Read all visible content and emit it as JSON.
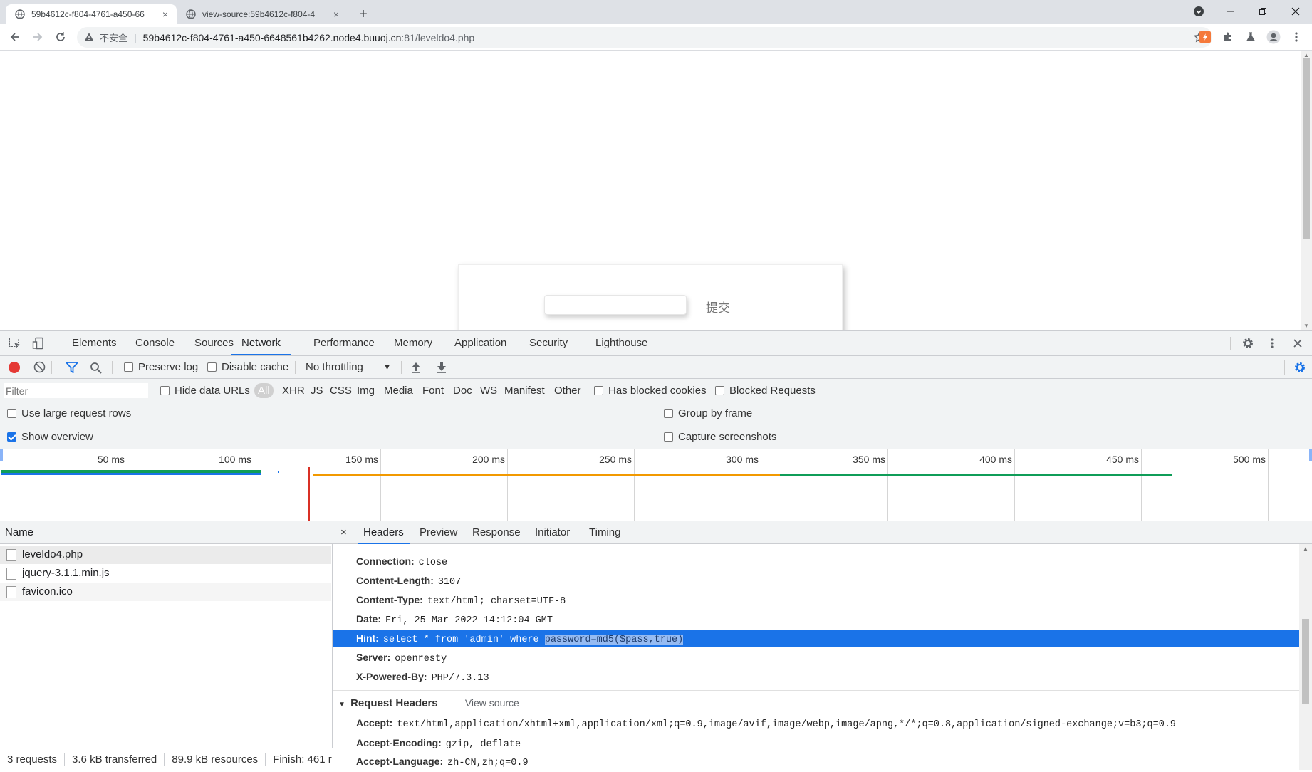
{
  "tabs": [
    {
      "title": "59b4612c-f804-4761-a450-66",
      "close": "×"
    },
    {
      "title": "view-source:59b4612c-f804-4",
      "close": "×"
    }
  ],
  "new_tab": "+",
  "toolbar": {
    "security_label": "不安全",
    "url_host": "59b4612c-f804-4761-a450-6648561b4262.node4.buuoj.cn",
    "url_path": ":81/leveldo4.php"
  },
  "page": {
    "input_value": "",
    "submit_label": "提交"
  },
  "devtools": {
    "tabs": [
      "Elements",
      "Console",
      "Sources",
      "Network",
      "Performance",
      "Memory",
      "Application",
      "Security",
      "Lighthouse"
    ],
    "active_tab": "Network",
    "preserve_log": "Preserve log",
    "disable_cache": "Disable cache",
    "throttling": "No throttling",
    "filter_placeholder": "Filter",
    "hide_data_urls": "Hide data URLs",
    "filter_types": [
      "All",
      "XHR",
      "JS",
      "CSS",
      "Img",
      "Media",
      "Font",
      "Doc",
      "WS",
      "Manifest",
      "Other"
    ],
    "has_blocked_cookies": "Has blocked cookies",
    "blocked_requests": "Blocked Requests",
    "large_rows": "Use large request rows",
    "show_overview": "Show overview",
    "group_by_frame": "Group by frame",
    "capture_screenshots": "Capture screenshots",
    "timeline_ticks": [
      "50 ms",
      "100 ms",
      "150 ms",
      "200 ms",
      "250 ms",
      "300 ms",
      "350 ms",
      "400 ms",
      "450 ms",
      "500 ms"
    ],
    "name_header": "Name",
    "requests": [
      "leveldo4.php",
      "jquery-3.1.1.min.js",
      "favicon.ico"
    ],
    "status": {
      "requests": "3 requests",
      "transferred": "3.6 kB transferred",
      "resources": "89.9 kB resources",
      "finish": "Finish: 461 r"
    },
    "detail_tabs": [
      "Headers",
      "Preview",
      "Response",
      "Initiator",
      "Timing"
    ],
    "response_headers": [
      {
        "k": "Connection:",
        "v": "close"
      },
      {
        "k": "Content-Length:",
        "v": "3107"
      },
      {
        "k": "Content-Type:",
        "v": "text/html; charset=UTF-8"
      },
      {
        "k": "Date:",
        "v": "Fri, 25 Mar 2022 14:12:04 GMT"
      },
      {
        "k": "Hint:",
        "v": "select * from 'admin' where ",
        "v2": "password=md5($pass,true)"
      },
      {
        "k": "Server:",
        "v": "openresty"
      },
      {
        "k": "X-Powered-By:",
        "v": "PHP/7.3.13"
      }
    ],
    "request_headers_title": "Request Headers",
    "view_source": "View source",
    "request_headers": [
      {
        "k": "Accept:",
        "v": "text/html,application/xhtml+xml,application/xml;q=0.9,image/avif,image/webp,image/apng,*/*;q=0.8,application/signed-exchange;v=b3;q=0.9"
      },
      {
        "k": "Accept-Encoding:",
        "v": "gzip, deflate"
      },
      {
        "k": "Accept-Language:",
        "v": "zh-CN,zh;q=0.9"
      }
    ]
  },
  "colors": {
    "accent": "#1a73e8",
    "record": "#e53935"
  }
}
